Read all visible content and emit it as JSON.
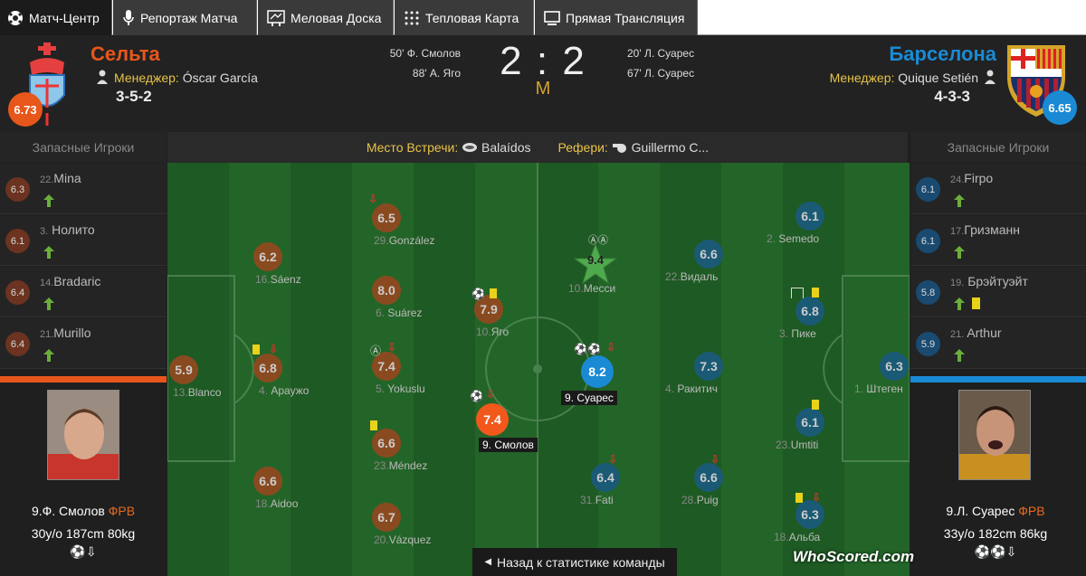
{
  "tabs": [
    {
      "label": "Матч-Центр",
      "icon": "football-icon"
    },
    {
      "label": "Репортаж Матча",
      "icon": "microphone-icon"
    },
    {
      "label": "Меловая Доска",
      "icon": "chalkboard-icon"
    },
    {
      "label": "Тепловая Карта",
      "icon": "heatmap-icon"
    },
    {
      "label": "Прямая Трансляция",
      "icon": "monitor-icon"
    }
  ],
  "home": {
    "name": "Сельта",
    "color": "#e7561b",
    "rating": "6.73",
    "manager_label": "Менеджер:",
    "manager": "Óscar García",
    "formation": "3-5-2",
    "goals": [
      "50' Ф. Смолов",
      "88' А. Яго"
    ],
    "subs_title": "Запасные Игроки",
    "subs": [
      {
        "num": "22.",
        "name": "Mina",
        "rating": "6.3"
      },
      {
        "num": "3.",
        "name": "Нолито",
        "rating": "6.1"
      },
      {
        "num": "14.",
        "name": "Bradaric",
        "rating": "6.4"
      },
      {
        "num": "21.",
        "name": "Murillo",
        "rating": "6.4"
      }
    ],
    "card": {
      "name": "9.Ф. Смолов",
      "pos": "ФРВ",
      "stats": "30у/о 187cm 80kg",
      "events": "⚽⇩"
    }
  },
  "away": {
    "name": "Барселона",
    "color": "#1a8ad4",
    "rating": "6.65",
    "manager_label": "Менеджер:",
    "manager": "Quique Setién",
    "formation": "4-3-3",
    "goals": [
      "20' Л. Суарес",
      "67' Л. Суарес"
    ],
    "subs_title": "Запасные Игроки",
    "subs": [
      {
        "num": "24.",
        "name": "Firpo",
        "rating": "6.1"
      },
      {
        "num": "17.",
        "name": "Гризманн",
        "rating": "6.1"
      },
      {
        "num": "19.",
        "name": "Брэйтуэйт",
        "rating": "5.8"
      },
      {
        "num": "21.",
        "name": "Arthur",
        "rating": "5.9"
      }
    ],
    "card": {
      "name": "9.Л. Суарес",
      "pos": "ФРВ",
      "stats": "33у/о 182cm 86kg",
      "events": "⚽⚽⇩"
    }
  },
  "score": {
    "home": "2",
    "sep": ":",
    "away": "2",
    "period": "M"
  },
  "venue": {
    "label": "Место Встречи:",
    "value": "Balaídos"
  },
  "referee": {
    "label": "Рефери:",
    "value": "Guillermo C..."
  },
  "pitch_players": [
    {
      "id": "p1",
      "num": "13.",
      "name": "Blanco",
      "rating": "5.9",
      "team": "home"
    },
    {
      "id": "p2",
      "num": "4.",
      "name": "Араужо",
      "rating": "6.8",
      "team": "home"
    },
    {
      "id": "p3",
      "num": "16.",
      "name": "Sáenz",
      "rating": "6.2",
      "team": "home"
    },
    {
      "id": "p4",
      "num": "18.",
      "name": "Aidoo",
      "rating": "6.6",
      "team": "home"
    },
    {
      "id": "p5",
      "num": "29.",
      "name": "González",
      "rating": "6.5",
      "team": "home"
    },
    {
      "id": "p6",
      "num": "6.",
      "name": "Suárez",
      "rating": "8.0",
      "team": "home"
    },
    {
      "id": "p7",
      "num": "5.",
      "name": "Yokuslu",
      "rating": "7.4",
      "team": "home"
    },
    {
      "id": "p8",
      "num": "23.",
      "name": "Méndez",
      "rating": "6.6",
      "team": "home"
    },
    {
      "id": "p9",
      "num": "20.",
      "name": "Vázquez",
      "rating": "6.7",
      "team": "home"
    },
    {
      "id": "p10",
      "num": "10.",
      "name": "Яго",
      "rating": "7.9",
      "team": "home"
    },
    {
      "id": "p11",
      "num": "9.",
      "name": "Смолов",
      "rating": "7.4",
      "team": "home",
      "selected": true
    },
    {
      "id": "p12",
      "num": "9.",
      "name": "Суарес",
      "rating": "8.2",
      "team": "away",
      "selected": true
    },
    {
      "id": "p13",
      "num": "10.",
      "name": "Месси",
      "rating": "9.4",
      "team": "away",
      "star": true
    },
    {
      "id": "p14",
      "num": "22.",
      "name": "Видаль",
      "rating": "6.6",
      "team": "away"
    },
    {
      "id": "p15",
      "num": "4.",
      "name": "Ракитич",
      "rating": "7.3",
      "team": "away"
    },
    {
      "id": "p16",
      "num": "31.",
      "name": "Fati",
      "rating": "6.4",
      "team": "away"
    },
    {
      "id": "p17",
      "num": "28.",
      "name": "Puig",
      "rating": "6.6",
      "team": "away"
    },
    {
      "id": "p18",
      "num": "2.",
      "name": "Semedo",
      "rating": "6.1",
      "team": "away"
    },
    {
      "id": "p19",
      "num": "3.",
      "name": "Пике",
      "rating": "6.8",
      "team": "away"
    },
    {
      "id": "p20",
      "num": "23.",
      "name": "Umtiti",
      "rating": "6.1",
      "team": "away"
    },
    {
      "id": "p21",
      "num": "18.",
      "name": "Альба",
      "rating": "6.3",
      "team": "away"
    },
    {
      "id": "p22",
      "num": "1.",
      "name": "Штеген",
      "rating": "6.3",
      "team": "away"
    }
  ],
  "back_label": "Назад к статистике команды",
  "brand": "WhoScored.com",
  "colors": {
    "home": "#e7561b",
    "away": "#1a8ad4",
    "pitch_dark": "#1e5a23",
    "pitch_light": "#246a2a",
    "card_yellow": "#e9d21a",
    "sub_arrow": "#6cae3b",
    "sub_out": "#e02020"
  }
}
